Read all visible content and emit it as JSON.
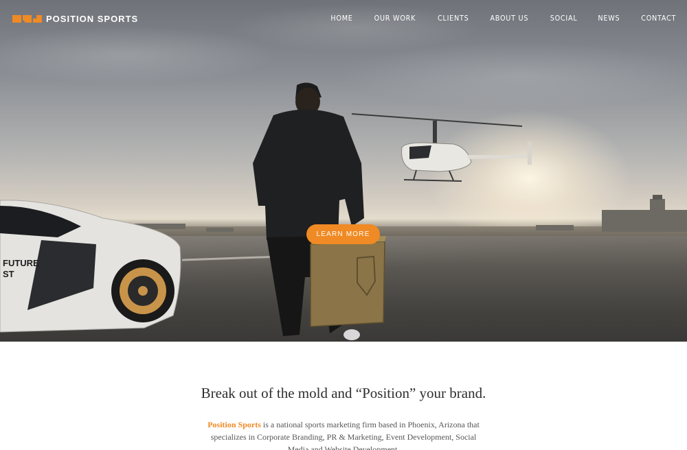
{
  "header": {
    "logo_text": "POSITION SPORTS",
    "nav": [
      "HOME",
      "OUR WORK",
      "CLIENTS",
      "ABOUT US",
      "SOCIAL",
      "NEWS",
      "CONTACT"
    ]
  },
  "hero": {
    "cta_label": "LEARN MORE",
    "car_decal_line1": "FUTURE",
    "car_decal_line2": "ST"
  },
  "intro": {
    "tagline": "Break out of the mold and “Position” your brand.",
    "brand_name": "Position Sports",
    "description": " is a national sports marketing firm based in Phoenix, Arizona that specializes in Corporate Branding, PR & Marketing, Event Development, Social Media and Website Development."
  },
  "colors": {
    "accent": "#f08a24",
    "text_dark": "#2e2e2e",
    "text_body": "#555555",
    "nav_text": "#ffffff"
  },
  "icons": [
    "logo-mark-icon"
  ]
}
